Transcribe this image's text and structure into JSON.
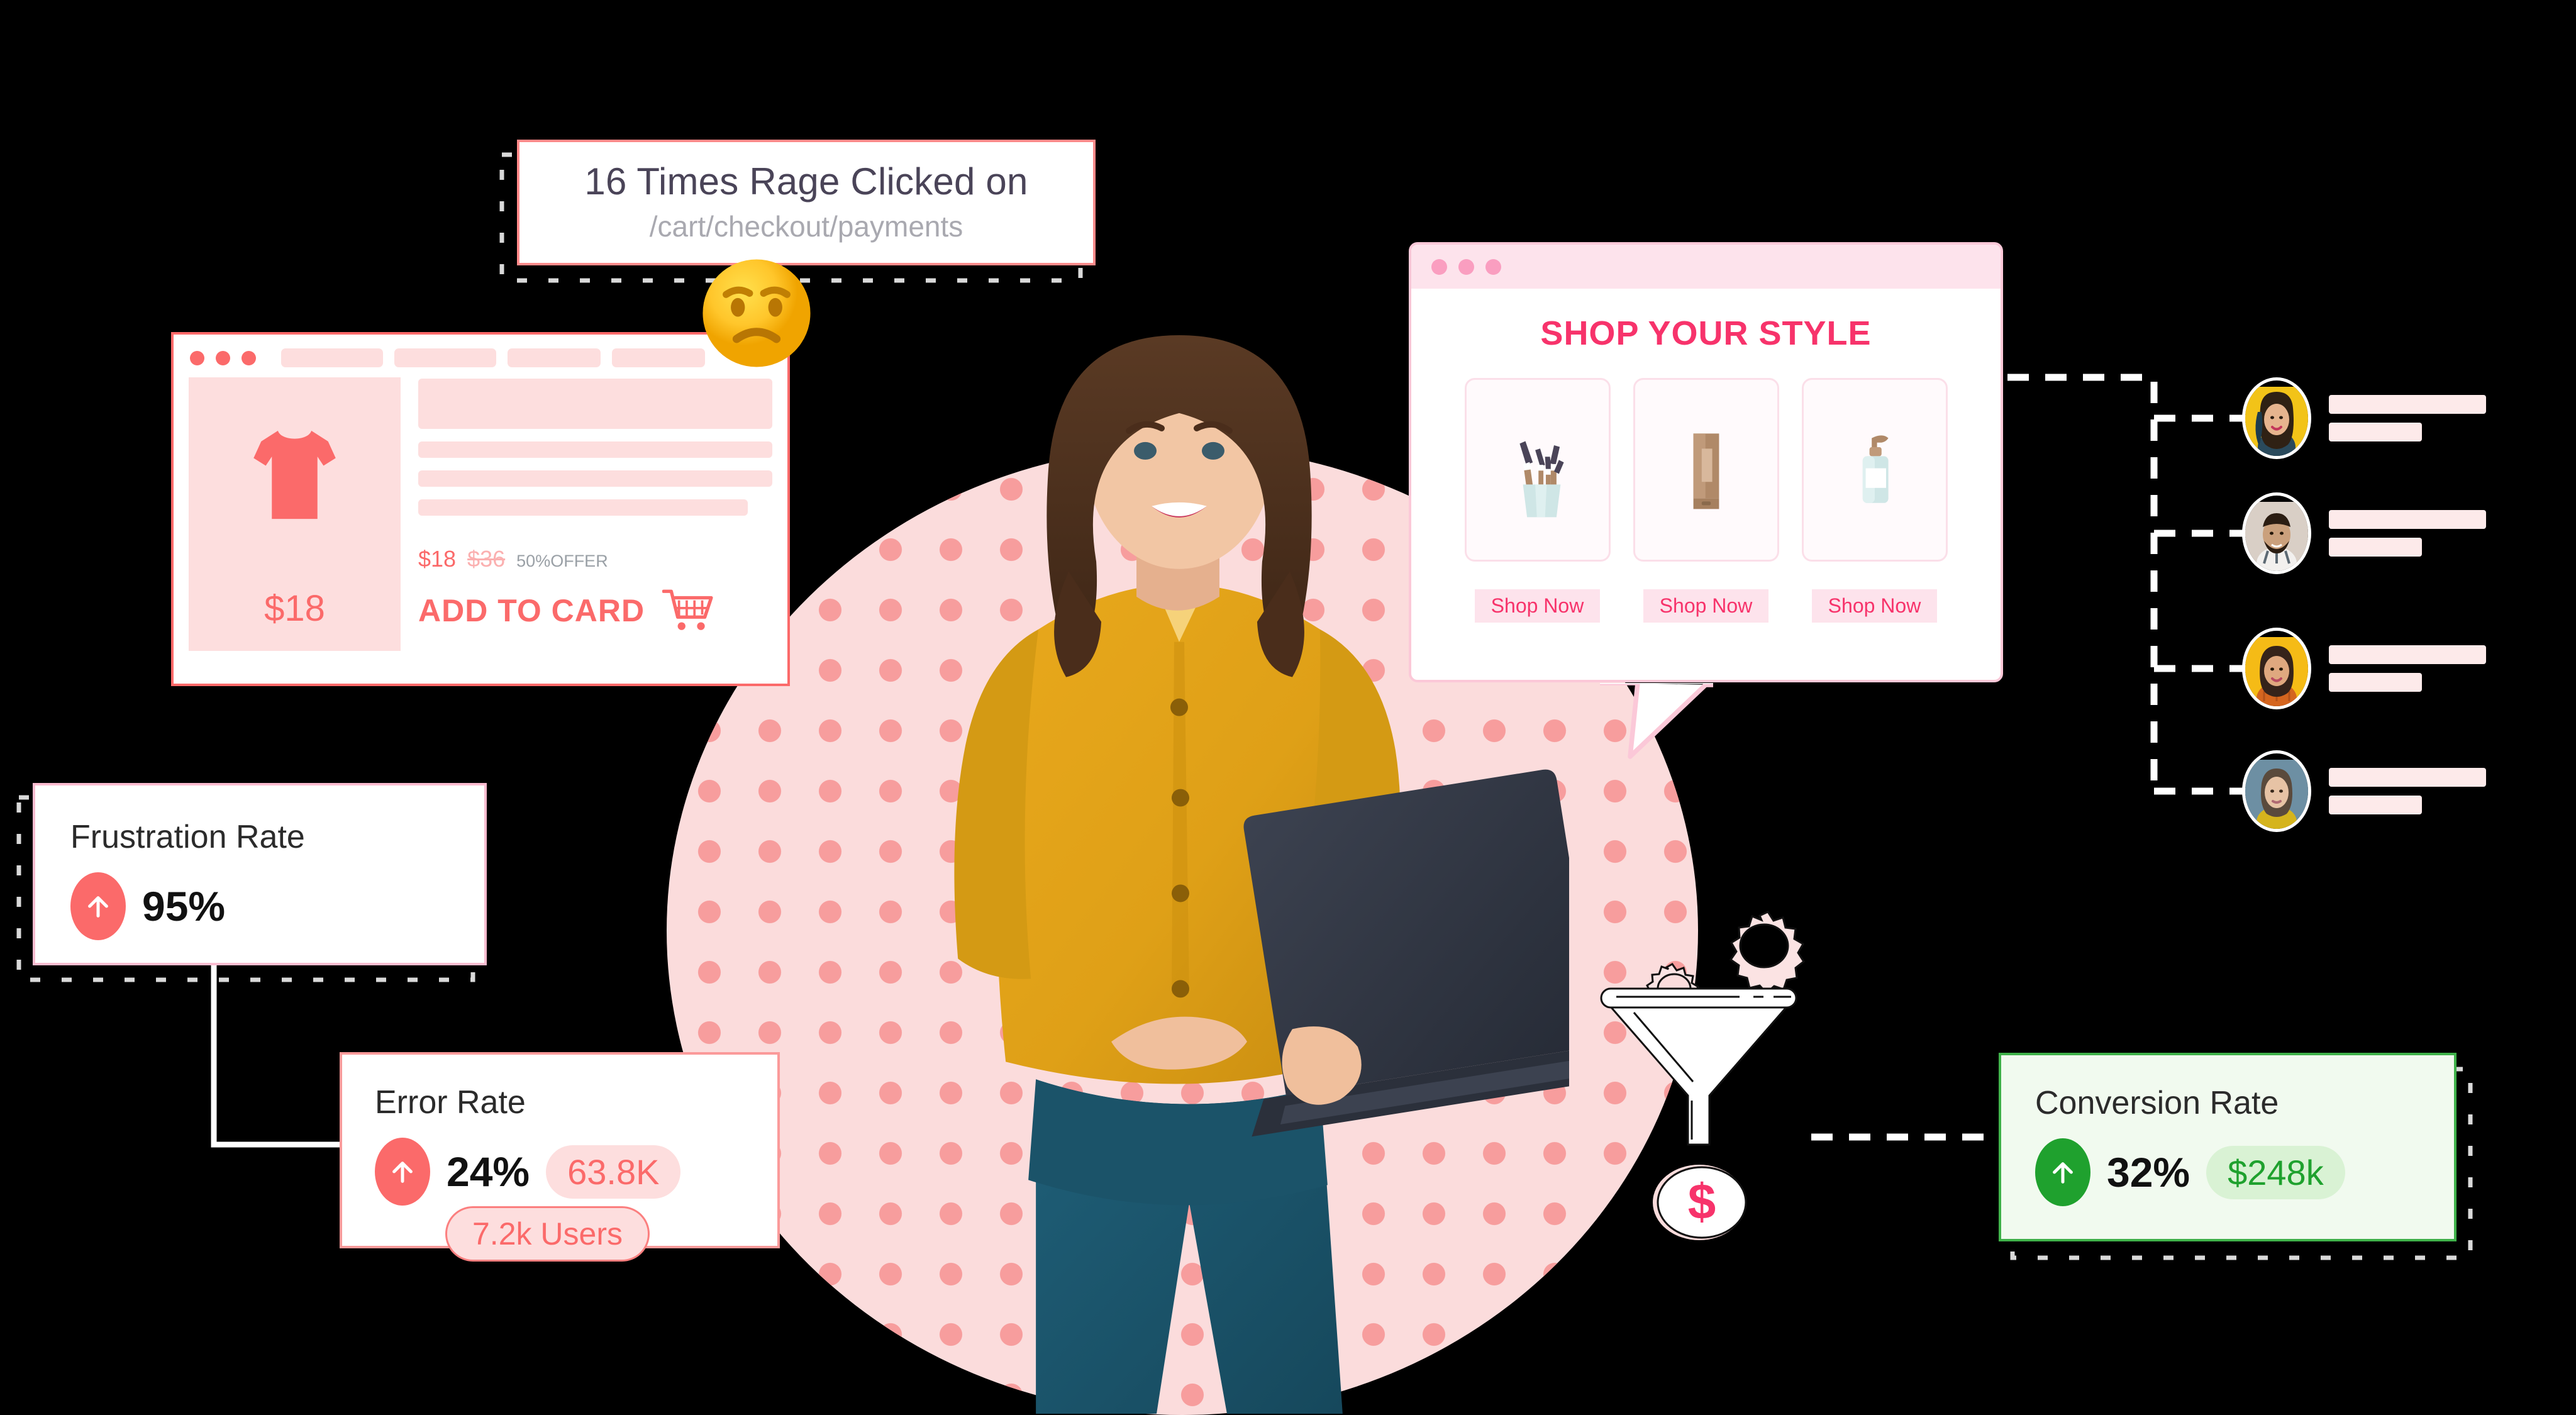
{
  "rage_alert": {
    "headline": "16 Times Rage Clicked on",
    "path": "/cart/checkout/payments",
    "emoji_name": "angry-face-emoji"
  },
  "product_card": {
    "thumb_price": "$18",
    "price_now": "$18",
    "price_old": "$36",
    "offer": "50%OFFER",
    "cta_label": "ADD  TO CARD",
    "cart_icon": "shopping-cart-icon",
    "window_dots": 3,
    "nav_pills": 4
  },
  "shop_panel": {
    "title": "SHOP YOUR STYLE",
    "window_dots": 3,
    "products": [
      {
        "icon": "makeup-brushes-icon",
        "button_label": "Shop Now"
      },
      {
        "icon": "cosmetic-tube-icon",
        "button_label": "Shop Now"
      },
      {
        "icon": "lotion-pump-bottle-icon",
        "button_label": "Shop Now"
      }
    ]
  },
  "metrics": {
    "frustration": {
      "title": "Frustration Rate",
      "value": "95%",
      "trend_icon": "up-arrow-icon",
      "accent": "#fb6a6a"
    },
    "error": {
      "title": "Error Rate",
      "value": "24%",
      "chip": "63.8K",
      "users_chip": "7.2k Users",
      "trend_icon": "up-arrow-icon",
      "accent": "#fb6a6a"
    },
    "conversion": {
      "title": "Conversion Rate",
      "value": "32%",
      "chip": "$248k",
      "trend_icon": "up-arrow-icon",
      "accent": "#3fb24a"
    }
  },
  "funnel": {
    "gear_large_icon": "gear-icon",
    "gear_small_icon": "gear-icon",
    "funnel_icon": "funnel-icon",
    "coin_icon": "dollar-coin-icon",
    "coin_symbol": "$"
  },
  "audience": {
    "rows": [
      {
        "avatar": "avatar-woman-yellow-hat"
      },
      {
        "avatar": "avatar-man-beard"
      },
      {
        "avatar": "avatar-woman-orange-shirt"
      },
      {
        "avatar": "avatar-woman-blue-background"
      }
    ]
  },
  "hero": {
    "person_image": "woman-with-laptop-photo",
    "laptop_icon": "laptop-icon"
  },
  "colors": {
    "coral": "#fb6a6a",
    "pink": "#f7336b",
    "pink_light": "#fddede",
    "green": "#3fb24a",
    "green_light": "#d9f2d4",
    "blob": "#fbdcdc",
    "dot": "#f79d9d"
  }
}
